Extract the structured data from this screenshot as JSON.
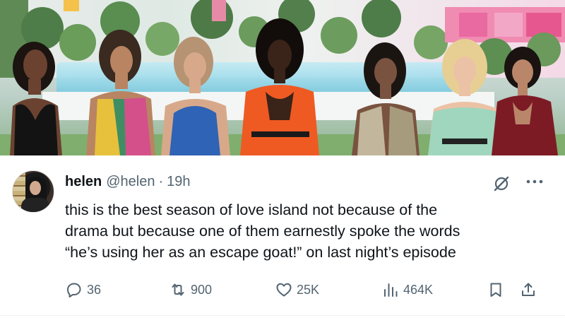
{
  "photo": {
    "alt_subject": "",
    "icon": "photo-image"
  },
  "tweet": {
    "author": {
      "name": "helen",
      "handle": "@helen",
      "separator": "·",
      "time": "19h",
      "avatar_icon": "avatar-photo"
    },
    "text_lines": [
      "this is the best season of love island not because of the",
      "drama but because one of them earnestly spoke the words",
      "“he’s using her as an escape goat!” on last night’s episode"
    ],
    "actions": {
      "replies": "36",
      "reposts": "900",
      "likes": "25K",
      "views": "464K"
    },
    "icons": {
      "grok": "grok-icon",
      "more": "more-icon",
      "reply": "reply-icon",
      "repost": "repost-icon",
      "like": "heart-icon",
      "views": "views-icon",
      "bookmark": "bookmark-icon",
      "share": "share-icon"
    },
    "colors": {
      "text": "#0f1419",
      "secondary": "#536471"
    }
  }
}
